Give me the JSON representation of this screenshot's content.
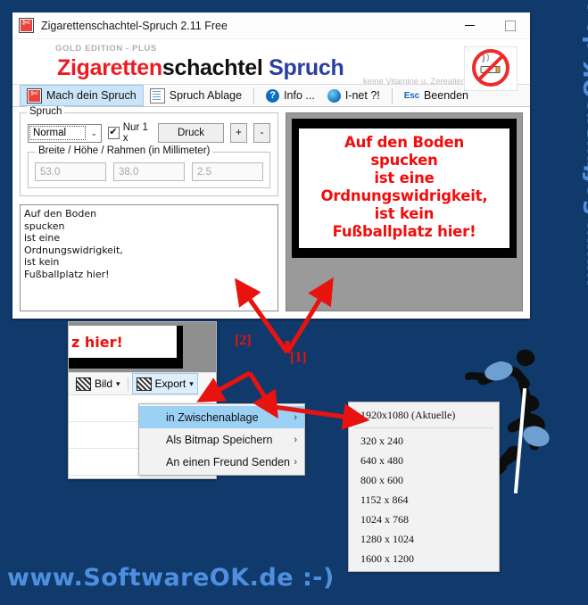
{
  "window": {
    "title": "Zigarettenschachtel-Spruch 2.11 Free",
    "icon": "scissors-icon",
    "minimize_label": "–",
    "maximize_label": "□"
  },
  "banner": {
    "edition": "GOLD EDITION - PLUS",
    "brand_red": "Zigaretten",
    "brand_black": "schachtel",
    "brand_blue": "Spruch",
    "slogan": "keine Vitamine u. Zerealien",
    "icon": "no-smoking-icon"
  },
  "toolbar": {
    "items": [
      {
        "label": "Mach dein Spruch",
        "icon": "scissors-icon",
        "active": true
      },
      {
        "label": "Spruch Ablage",
        "icon": "document-icon",
        "active": false
      },
      {
        "label": "Info ...",
        "icon": "info-icon",
        "active": false
      },
      {
        "label": "I-net ?!",
        "icon": "globe-icon",
        "active": false
      },
      {
        "label": "Beenden",
        "icon": "esc-icon",
        "active": false
      }
    ],
    "esc_badge": "Esc"
  },
  "spruch_group": {
    "legend": "Spruch",
    "style_combo": {
      "value": "Normal",
      "arrow": "⌄"
    },
    "checkbox": {
      "label": "Nur 1 x",
      "checked": true
    },
    "print_button": "Druck",
    "plus_button": "+",
    "minus_button": "-",
    "dims_legend": "Breite / Höhe / Rahmen (in Millimeter)",
    "dims": [
      {
        "name": "breite",
        "value": "53.0"
      },
      {
        "name": "hoehe",
        "value": "38.0"
      },
      {
        "name": "rahmen",
        "value": "2.5"
      }
    ]
  },
  "editor": {
    "text": "Auf den Boden\nspucken\nist eine\nOrdnungswidrigkeit,\nist kein\nFußballplatz hier!"
  },
  "preview": {
    "lines": [
      "Auf den Boden",
      "spucken",
      "ist eine",
      "Ordnungswidrigkeit,",
      "ist kein",
      "Fußballplatz hier!"
    ],
    "text_color": "#f20d0d",
    "background": "#000000",
    "paper": "#ffffff"
  },
  "second_window": {
    "preview_fragment": "z hier!",
    "buttons": [
      {
        "label": "Bild",
        "icon": "image-icon",
        "caret": "▾",
        "selected": false
      },
      {
        "label": "Export",
        "icon": "image-icon",
        "caret": "▾",
        "selected": true
      }
    ]
  },
  "export_menu": {
    "items": [
      {
        "label": "in Zwischenablage",
        "submenu_arrow": "›",
        "highlighted": true
      },
      {
        "label": "Als Bitmap Speichern",
        "submenu_arrow": "›",
        "highlighted": false
      },
      {
        "label": "An einen Freund Senden",
        "submenu_arrow": "›",
        "highlighted": false
      }
    ]
  },
  "resolution_menu": {
    "current": "1920x1080 (Aktuelle)",
    "items": [
      "320 x 240",
      "640 x 480",
      "800 x 600",
      "1152 x 864",
      "1024 x 768",
      "1280 x 1024",
      "1600 x 1200"
    ]
  },
  "annotations": [
    {
      "label": "[1]",
      "color": "#e8120e"
    },
    {
      "label": "[2]",
      "color": "#e8120e"
    }
  ],
  "watermarks": {
    "right": "www.SoftwareOK.de  :-)",
    "bottom": "www.SoftwareOK.de  :-)",
    "color": "#4e8fe0"
  },
  "colors": {
    "page_background": "#103a6b",
    "accent_red": "#ec1c24",
    "accent_blue": "#2b3fa0",
    "highlight": "#9bd1f5"
  }
}
